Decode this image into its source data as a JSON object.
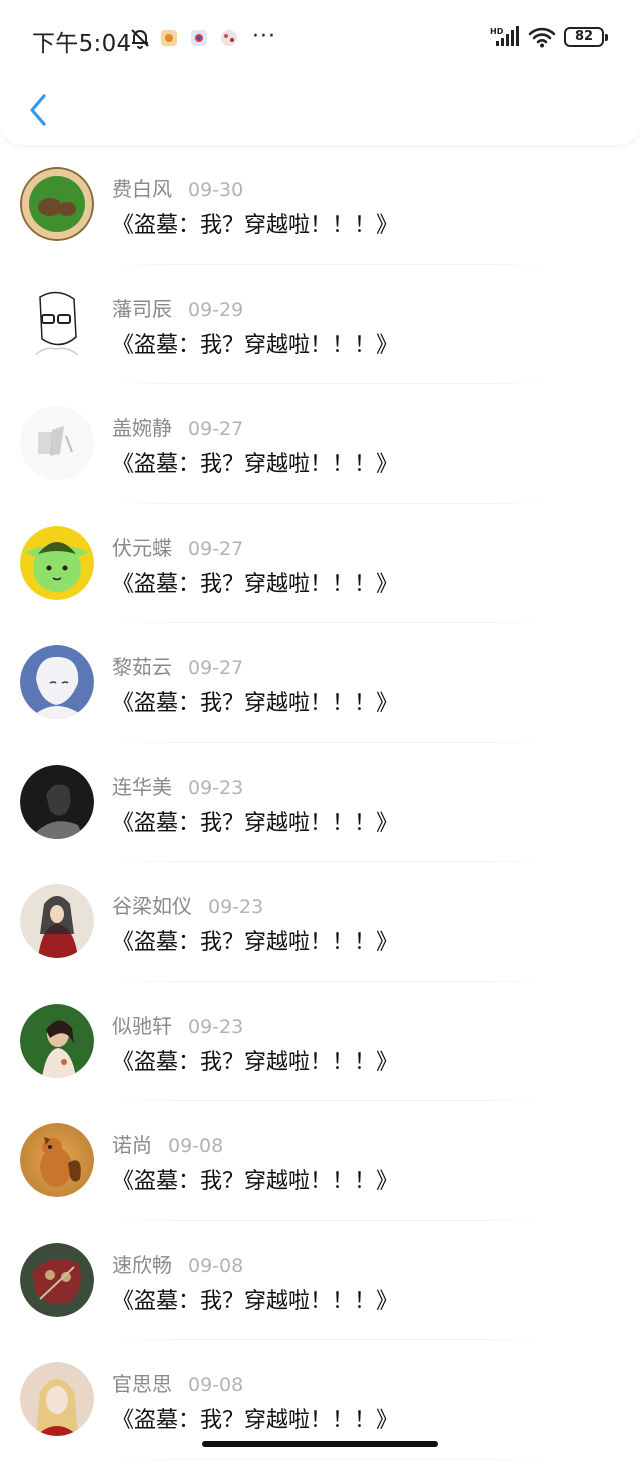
{
  "status_bar": {
    "time": "下午5:04",
    "battery": "82",
    "icons": [
      "bell-off-icon",
      "app-icon",
      "app-icon",
      "app-icon",
      "more-dots-icon",
      "hd-signal-icon",
      "wifi-icon",
      "battery-icon"
    ],
    "more": "···"
  },
  "header": {
    "back_icon": "chevron-left-icon",
    "accent_color": "#2f9bea"
  },
  "messages": [
    {
      "name": "费白风",
      "date": "09-30",
      "text": "《盗墓：我？穿越啦！！！》",
      "avatar_colors": [
        "#e7c99a",
        "#3f8f2e",
        "#6b4a2b"
      ]
    },
    {
      "name": "藩司辰",
      "date": "09-29",
      "text": "《盗墓：我？穿越啦！！！》",
      "avatar_colors": [
        "#ffffff",
        "#222222",
        "#cccccc"
      ]
    },
    {
      "name": "盖婉静",
      "date": "09-27",
      "text": "《盗墓：我？穿越啦！！！》",
      "avatar_colors": [
        "#f8f8f8",
        "#d9d9d9",
        "#bdbdbd"
      ]
    },
    {
      "name": "伏元蝶",
      "date": "09-27",
      "text": "《盗墓：我？穿越啦！！！》",
      "avatar_colors": [
        "#f4d21a",
        "#8fe06a",
        "#3c5a1d"
      ]
    },
    {
      "name": "黎茹云",
      "date": "09-27",
      "text": "《盗墓：我？穿越啦！！！》",
      "avatar_colors": [
        "#5b77b5",
        "#f2f2f5",
        "#2d3a5c"
      ]
    },
    {
      "name": "连华美",
      "date": "09-23",
      "text": "《盗墓：我？穿越啦！！！》",
      "avatar_colors": [
        "#1a1a1a",
        "#3a3a3a",
        "#707070"
      ]
    },
    {
      "name": "谷梁如仪",
      "date": "09-23",
      "text": "《盗墓：我？穿越啦！！！》",
      "avatar_colors": [
        "#e8e2d8",
        "#9c1f1f",
        "#2a2a2a"
      ]
    },
    {
      "name": "似驰轩",
      "date": "09-23",
      "text": "《盗墓：我？穿越啦！！！》",
      "avatar_colors": [
        "#2f6b2a",
        "#f3e4d8",
        "#c26a3a"
      ]
    },
    {
      "name": "诺尚",
      "date": "09-08",
      "text": "《盗墓：我？穿越啦！！！》",
      "avatar_colors": [
        "#c9762c",
        "#e9a94c",
        "#6e3b12"
      ]
    },
    {
      "name": "速欣畅",
      "date": "09-08",
      "text": "《盗墓：我？穿越啦！！！》",
      "avatar_colors": [
        "#3d4c3a",
        "#8b2a2a",
        "#c9a77a"
      ]
    },
    {
      "name": "官思思",
      "date": "09-08",
      "text": "《盗墓：我？穿越啦！！！》",
      "avatar_colors": [
        "#e8d6c8",
        "#b01e1e",
        "#e5c77a"
      ]
    }
  ]
}
